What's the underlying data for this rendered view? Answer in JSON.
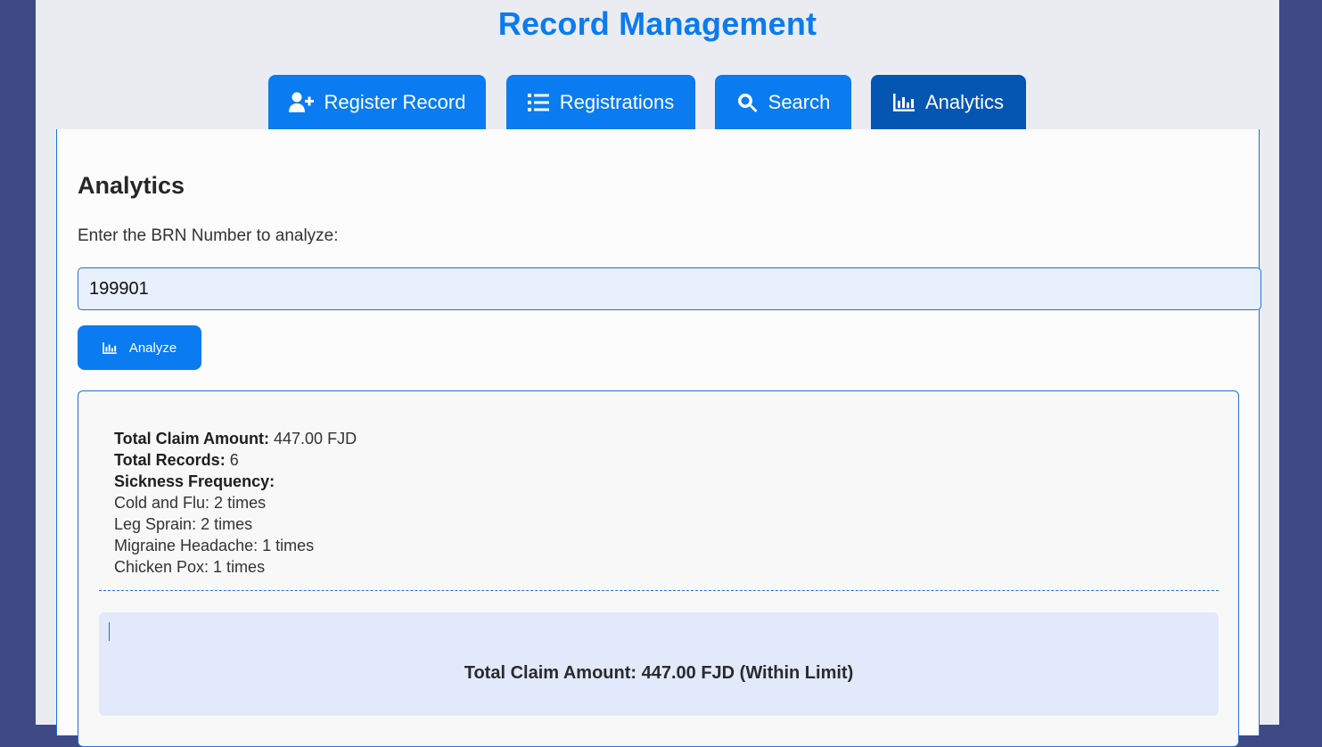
{
  "app": {
    "title": "Record Management"
  },
  "tabs": [
    {
      "label": "Register Record",
      "icon": "user-plus-icon"
    },
    {
      "label": "Registrations",
      "icon": "list-icon"
    },
    {
      "label": "Search",
      "icon": "search-icon"
    },
    {
      "label": "Analytics",
      "icon": "chart-bar-icon",
      "active": true
    }
  ],
  "analytics": {
    "heading": "Analytics",
    "prompt": "Enter the BRN Number to analyze:",
    "brn_value": "199901",
    "analyze_label": "Analyze",
    "results": {
      "total_claim_label": "Total Claim Amount:",
      "total_claim_value": "447.00 FJD",
      "total_records_label": "Total Records:",
      "total_records_value": "6",
      "frequency_label": "Sickness Frequency:",
      "frequency": [
        "Cold and Flu: 2 times",
        "Leg Sprain: 2 times",
        "Migraine Headache: 1 times",
        "Chicken Pox: 1 times"
      ],
      "summary": "Total Claim Amount: 447.00 FJD (Within Limit)"
    }
  },
  "colors": {
    "primary": "#0a7bf0",
    "active_tab": "#0555b3",
    "outer_background": "#3d4a84",
    "summary_background": "#e1e9fa"
  }
}
